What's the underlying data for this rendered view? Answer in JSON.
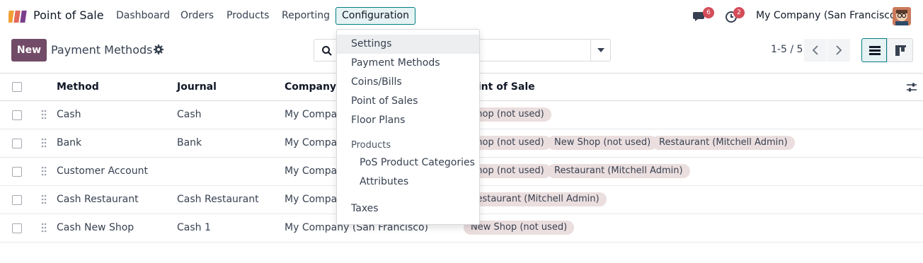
{
  "app": {
    "name": "Point of Sale"
  },
  "nav": {
    "items": [
      "Dashboard",
      "Orders",
      "Products",
      "Reporting",
      "Configuration"
    ]
  },
  "systray": {
    "messages_count": "6",
    "activities_count": "2",
    "company": "My Company (San Francisco)"
  },
  "control": {
    "new_label": "New",
    "title": "Payment Methods",
    "pager": "1-5 / 5"
  },
  "table": {
    "headers": [
      "Method",
      "Journal",
      "Company",
      "Point of Sale"
    ],
    "rows": [
      {
        "method": "Cash",
        "journal": "Cash",
        "company": "My Company (San Francisco)",
        "tags": [
          "Shop (not used)"
        ]
      },
      {
        "method": "Bank",
        "journal": "Bank",
        "company": "My Company (San Francisco)",
        "tags": [
          "Shop (not used)",
          "New Shop (not used)",
          "Restaurant (Mitchell Admin)"
        ]
      },
      {
        "method": "Customer Account",
        "journal": "",
        "company": "My Company (San Francisco)",
        "tags": [
          "Shop (not used)",
          "Restaurant (Mitchell Admin)"
        ]
      },
      {
        "method": "Cash Restaurant",
        "journal": "Cash Restaurant",
        "company": "My Company (San Francisco)",
        "tags": [
          "Restaurant (Mitchell Admin)"
        ]
      },
      {
        "method": "Cash New Shop",
        "journal": "Cash 1",
        "company": "My Company (San Francisco)",
        "tags": [
          "New Shop (not used)"
        ]
      }
    ]
  },
  "config_menu": {
    "items": [
      "Settings",
      "Payment Methods",
      "Coins/Bills",
      "Point of Sales",
      "Floor Plans"
    ],
    "products_header": "Products",
    "product_items": [
      "PoS Product Categories",
      "Attributes"
    ],
    "taxes": "Taxes"
  },
  "colors": {
    "primary": "#714b67",
    "accent": "#017e84",
    "tag": "#ebdede",
    "badge": "#d44c59"
  }
}
